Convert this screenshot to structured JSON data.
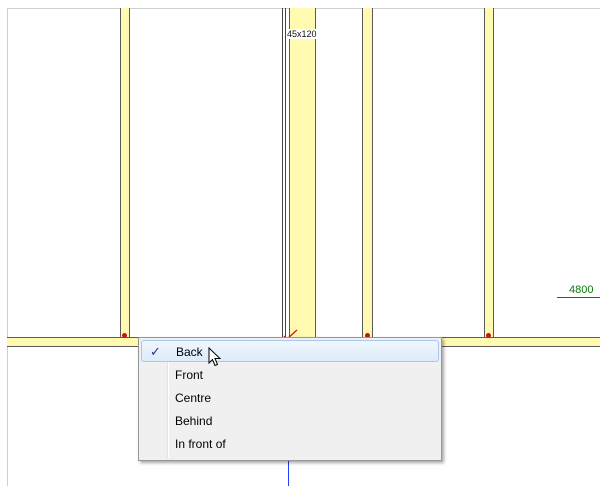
{
  "drawing": {
    "member_size_label": "45x120",
    "dimension_label": "4800"
  },
  "context_menu": {
    "items": [
      {
        "label": "Back",
        "checked": true,
        "highlighted": true
      },
      {
        "label": "Front",
        "checked": false,
        "highlighted": false
      },
      {
        "label": "Centre",
        "checked": false,
        "highlighted": false
      },
      {
        "label": "Behind",
        "checked": false,
        "highlighted": false
      },
      {
        "label": "In front of",
        "checked": false,
        "highlighted": false
      }
    ]
  },
  "colors": {
    "timber_fill": "#fffab0",
    "dimension_color": "#0a7a0a",
    "axis_color": "#1f3fff",
    "marker_color": "#cc1111"
  }
}
